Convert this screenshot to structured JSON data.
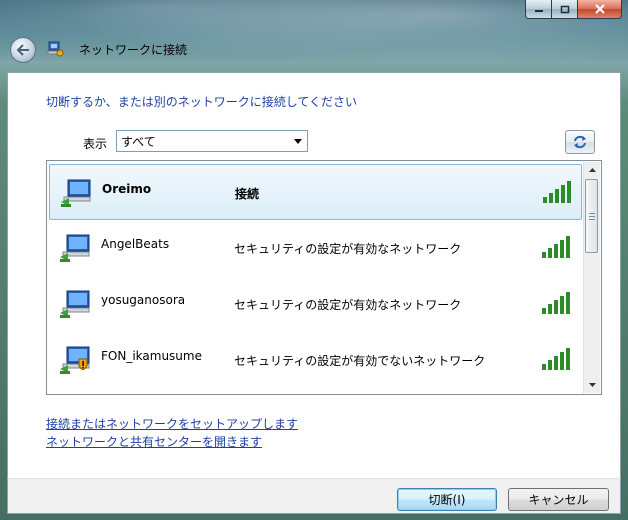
{
  "window": {
    "title": "ネットワークに接続"
  },
  "main": {
    "instruction": "切断するか、または別のネットワークに接続してください",
    "filter_label": "表示",
    "filter_value": "すべて"
  },
  "networks": [
    {
      "name": "Oreimo",
      "status": "接続",
      "selected": true,
      "secured": true,
      "warning": false,
      "signal_bars": 5
    },
    {
      "name": "AngelBeats",
      "status": "セキュリティの設定が有効なネットワーク",
      "selected": false,
      "secured": true,
      "warning": false,
      "signal_bars": 5
    },
    {
      "name": "yosuganosora",
      "status": "セキュリティの設定が有効なネットワーク",
      "selected": false,
      "secured": true,
      "warning": false,
      "signal_bars": 5
    },
    {
      "name": "FON_ikamusume",
      "status": "セキュリティの設定が有効でないネットワーク",
      "selected": false,
      "secured": false,
      "warning": true,
      "signal_bars": 5
    }
  ],
  "links": {
    "setup": "接続またはネットワークをセットアップします",
    "sharing_center": "ネットワークと共有センターを開きます"
  },
  "buttons": {
    "disconnect": "切断(I)",
    "cancel": "キャンセル"
  },
  "icons": {
    "back": "back-arrow-icon",
    "window": "network-connect-icon",
    "refresh": "refresh-icon",
    "network": "wireless-network-icon",
    "warning": "security-warning-shield-icon",
    "signal": "signal-strength-icon"
  },
  "colors": {
    "link": "#1f3fa6",
    "selected_row": "#dbeef9",
    "signal": "#2f8a2a"
  }
}
